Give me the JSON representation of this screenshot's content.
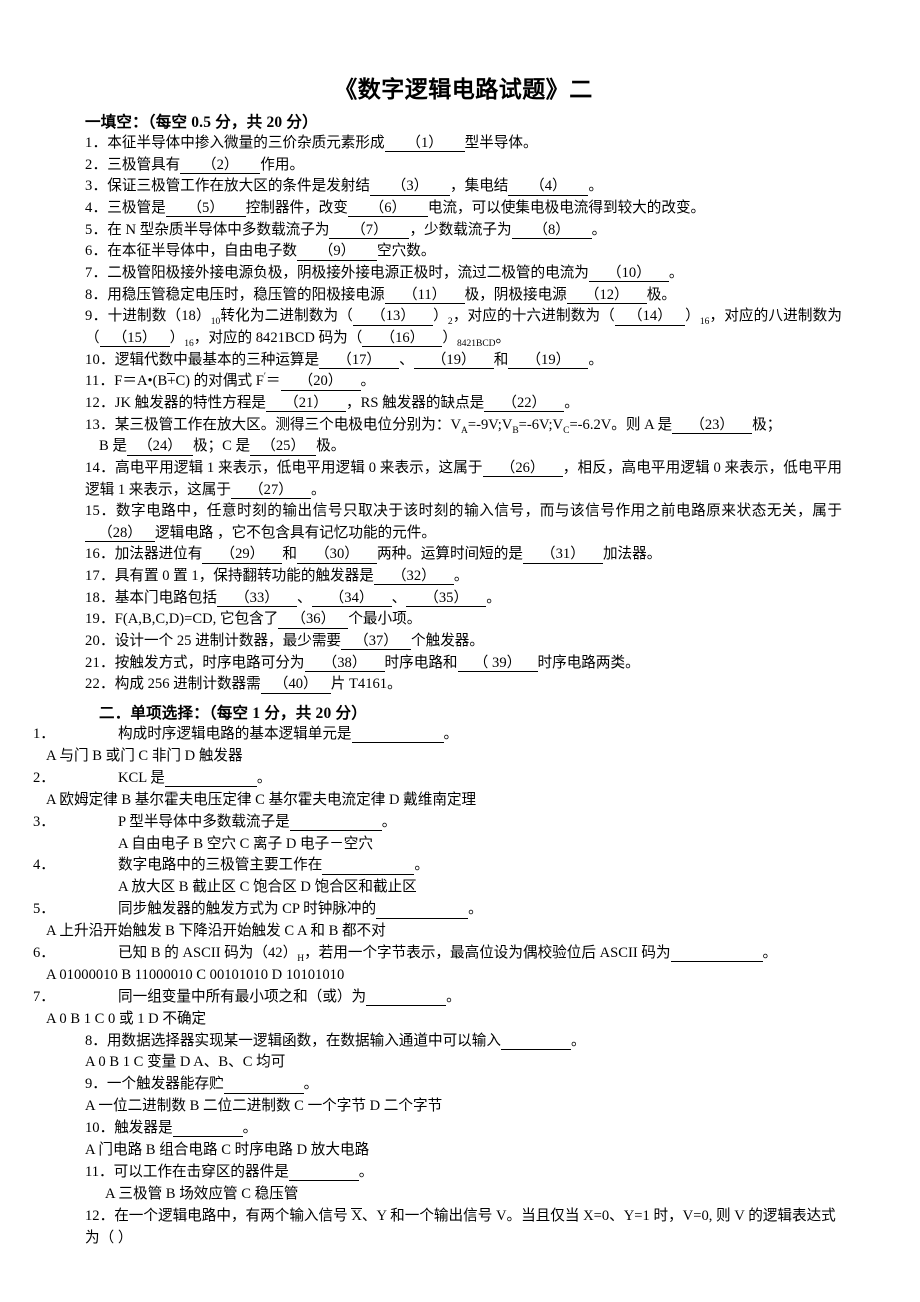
{
  "document": {
    "title": "《数字逻辑电路试题》",
    "title_suffix": "二"
  },
  "section_fill": {
    "heading": "一填空：（每空 0.5 分，共 20 分）",
    "questions": [
      {
        "num": "1．",
        "before": "本征半导体中掺入微量的三价杂质元素形成",
        "blanks": [
          "（1）"
        ],
        "after": "型半导体。"
      },
      {
        "num": "2．",
        "before": "三极管具有",
        "blanks": [
          "（2）"
        ],
        "after": "作用。"
      },
      {
        "num": "3．",
        "before": "保证三极管工作在放大区的条件是发射结",
        "blanks": [
          "（3）"
        ],
        "mid": "，集电结",
        "blanks2": [
          "（4）"
        ],
        "after": "。"
      },
      {
        "num": "4．",
        "before": "三极管是",
        "blanks": [
          "（5）"
        ],
        "mid": "控制器件，改变",
        "blanks2": [
          "（6）"
        ],
        "after": "电流，可以使集电极电流得到较大的改变。"
      },
      {
        "num": "5．",
        "before": "在 N 型杂质半导体中多数载流子为",
        "blanks": [
          "（7）"
        ],
        "mid": "，少数载流子为",
        "blanks2": [
          "（8）"
        ],
        "after": "。"
      },
      {
        "num": "6．",
        "before": "在本征半导体中，自由电子数",
        "blanks": [
          "（9）"
        ],
        "after": "空穴数。"
      },
      {
        "num": "7．",
        "before": "二极管阳极接外接电源负极，阴极接外接电源正极时，流过二极管的电流为",
        "blanks": [
          "（10）"
        ],
        "after": "。"
      },
      {
        "num": "8．",
        "before": "用稳压管稳定电压时，稳压管的阳极接电源",
        "blanks": [
          "（11）"
        ],
        "mid": "极，阴极接电源",
        "blanks2": [
          "（12）"
        ],
        "after": "极。"
      },
      {
        "num": "10．",
        "before": "逻辑代数中最基本的三种运算是",
        "blanks": [
          "（17）"
        ],
        "mid": "、",
        "blanks2": [
          "（19）"
        ],
        "mid2": "和",
        "blanks3": [
          "（19）"
        ],
        "after": "。"
      },
      {
        "num": "12．",
        "before": "JK 触发器的特性方程是",
        "blanks": [
          "（21）"
        ],
        "mid": "，RS 触发器的缺点是",
        "blanks2": [
          "（22）"
        ],
        "after": "。"
      },
      {
        "num": "15．",
        "before": "数字电路中，任意时刻的输出信号只取决于该时刻的输入信号，而与该信号作用之前电路原来状态无关，属于",
        "blanks": [
          "（28）"
        ],
        "after": "逻辑电路 ，它不包含具有记忆功能的元件。"
      },
      {
        "num": "16．",
        "before": "加法器进位有",
        "blanks": [
          "（29）"
        ],
        "mid": "和",
        "blanks2": [
          "（30）"
        ],
        "mid2": "两种。运算时间短的是",
        "blanks3": [
          "（31）"
        ],
        "after": "加法器。"
      },
      {
        "num": "17．",
        "before": "具有置 0 置 1，保持翻转功能的触发器是",
        "blanks": [
          "（32）"
        ],
        "after": "。"
      },
      {
        "num": "18．",
        "before": "基本门电路包括",
        "blanks": [
          "（33）"
        ],
        "mid": "、",
        "blanks2": [
          "（34）"
        ],
        "mid2": "、",
        "blanks3": [
          "（35）"
        ],
        "after": "。"
      },
      {
        "num": "19．",
        "before": "F(A,B,C,D)=CD, 它包含了",
        "blanks": [
          "（36）"
        ],
        "after": "个最小项。"
      },
      {
        "num": "20．",
        "before": "设计一个 25 进制计数器，最少需要",
        "blanks": [
          "（37）"
        ],
        "after": "个触发器。"
      },
      {
        "num": "21．",
        "before": "按触发方式，时序电路可分为",
        "blanks": [
          "（38）"
        ],
        "mid": "时序电路和",
        "blanks2": [
          "（ 39）"
        ],
        "after": "时序电路两类。"
      },
      {
        "num": "22．",
        "before": "构成 256 进制计数器需",
        "blanks": [
          "（40）"
        ],
        "after": "片 T4161。"
      }
    ],
    "q9": {
      "num": "9．",
      "t1": "十进制数（18）",
      "sub1": "10",
      "t2": "转化为二进制数为（",
      "b1": "（13）",
      "t3": "）",
      "sub2": "2",
      "t4": "，对应的十六进制数为（",
      "b2": "（14）",
      "t5": "）",
      "sub3": "16",
      "t6": "，对应的八进制数为（",
      "b3": "（15）",
      "t7": "）",
      "sub4": "16",
      "t8": "，对应的 8421BCD 码为（",
      "b4": "（16）",
      "t9": "）",
      "sub5": "8421BCD",
      "t10": "。"
    },
    "q11": {
      "num": "11．",
      "t1": "F＝A•(B",
      "ovl": "+",
      "t2": "C) 的对偶式 F",
      "prime": "′",
      "t3": "＝",
      "b1": "（20）",
      "t4": "。"
    },
    "q13": {
      "num": "13．",
      "t1": "某三极管工作在放大区。测得三个电极电位分别为：V",
      "sub1": "A",
      "t2": "=-9V;V",
      "sub2": "B",
      "t3": "=-6V;V",
      "sub3": "C",
      "t4": "=-6.2V。则 A 是",
      "b1": "（23）",
      "t5": "极；",
      "t6": "B 是",
      "b2": "（24）",
      "t7": "极；C 是",
      "b3": "（25）",
      "t8": "极。"
    },
    "q14": {
      "num": "14．",
      "t1": "高电平用逻辑 1 来表示，低电平用逻辑 0 来表示，这属于",
      "b1": "（26）",
      "t2": "，相反，高电平用逻辑 0 来表示，低电平用逻辑 1 来表示，这属于",
      "b2": "（27）",
      "t3": "。"
    }
  },
  "section_mc": {
    "heading": "二．单项选择：（每空 1 分，共 20 分）",
    "items": [
      {
        "num": "1．",
        "stem_before": "构成时序逻辑电路的基本逻辑单元是",
        "stem_after": "。",
        "options": "A  与门          B  或门          C  非门          D   触发器",
        "opt_indent": "indent1"
      },
      {
        "num": "2．",
        "stem_before": "KCL 是",
        "stem_after": "。",
        "options": "A  欧姆定律   B   基尔霍夫电压定律   C   基尔霍夫电流定律   D   戴维南定理",
        "opt_indent": "indent1"
      },
      {
        "num": "3．",
        "stem_before": "P 型半导体中多数载流子是",
        "stem_after": "。",
        "options": "A  自由电子   B  空穴  C  离子  D  电子－空穴",
        "opt_indent": "indent3"
      },
      {
        "num": "4．",
        "stem_before": "数字电路中的三极管主要工作在",
        "stem_after": "。",
        "options": "A  放大区  B  截止区  C  饱合区  D  饱合区和截止区",
        "opt_indent": "indent3"
      },
      {
        "num": "5．",
        "stem_before": "同步触发器的触发方式为 CP 时钟脉冲的",
        "stem_after": "。",
        "options": "A  上升沿开始触发       B 下降沿开始触发        C  A 和 B 都不对",
        "opt_indent": "indent1"
      },
      {
        "num": "6．",
        "stem_before": "已知 B 的 ASCII 码为（42）",
        "stem_sub": "H",
        "stem_mid": "，若用一个字节表示，最高位设为偶校验位后 ASCII 码为",
        "stem_after": "。",
        "options": "A  01000010  B  11000010  C  00101010  D  10101010",
        "opt_indent": "indent1"
      },
      {
        "num": "7．",
        "stem_before": "同一组变量中所有最小项之和（或）为",
        "stem_after": "。",
        "options": "A 0  B  1  C 0 或 1  D  不确定",
        "opt_indent": "indent1"
      }
    ],
    "flat_items": [
      {
        "num": "8．",
        "stem_before": "用数据选择器实现某一逻辑函数，在数据输入通道中可以输入",
        "stem_after": "。",
        "options": "A 0   B  1      C   变量     D A、B、C 均可"
      },
      {
        "num": "9．",
        "stem_before": "一个触发器能存贮",
        "stem_after": "。",
        "options": "A  一位二进制数  B  二位二进制数  C  一个字节  D  二个字节"
      },
      {
        "num": "10．",
        "stem_before": "触发器是",
        "stem_after": "。",
        "options": "A  门电路  B  组合电路  C  时序电路  D  放大电路"
      },
      {
        "num": "11．",
        "stem_before": "可以工作在击穿区的器件是",
        "stem_after": "。",
        "options": "A   三极管        B   场效应管        C   稳压管",
        "opt_indent": "indent1"
      }
    ],
    "item12": {
      "num": "12．",
      "t1": "在一个逻辑电路中，有两个输入信号 ",
      "ovl1": "X",
      "t2": "、Y 和一个输出信号 V。当且仅当 X=0、Y=1 时，V=0, 则 V 的逻辑表达式为（  ）"
    }
  }
}
